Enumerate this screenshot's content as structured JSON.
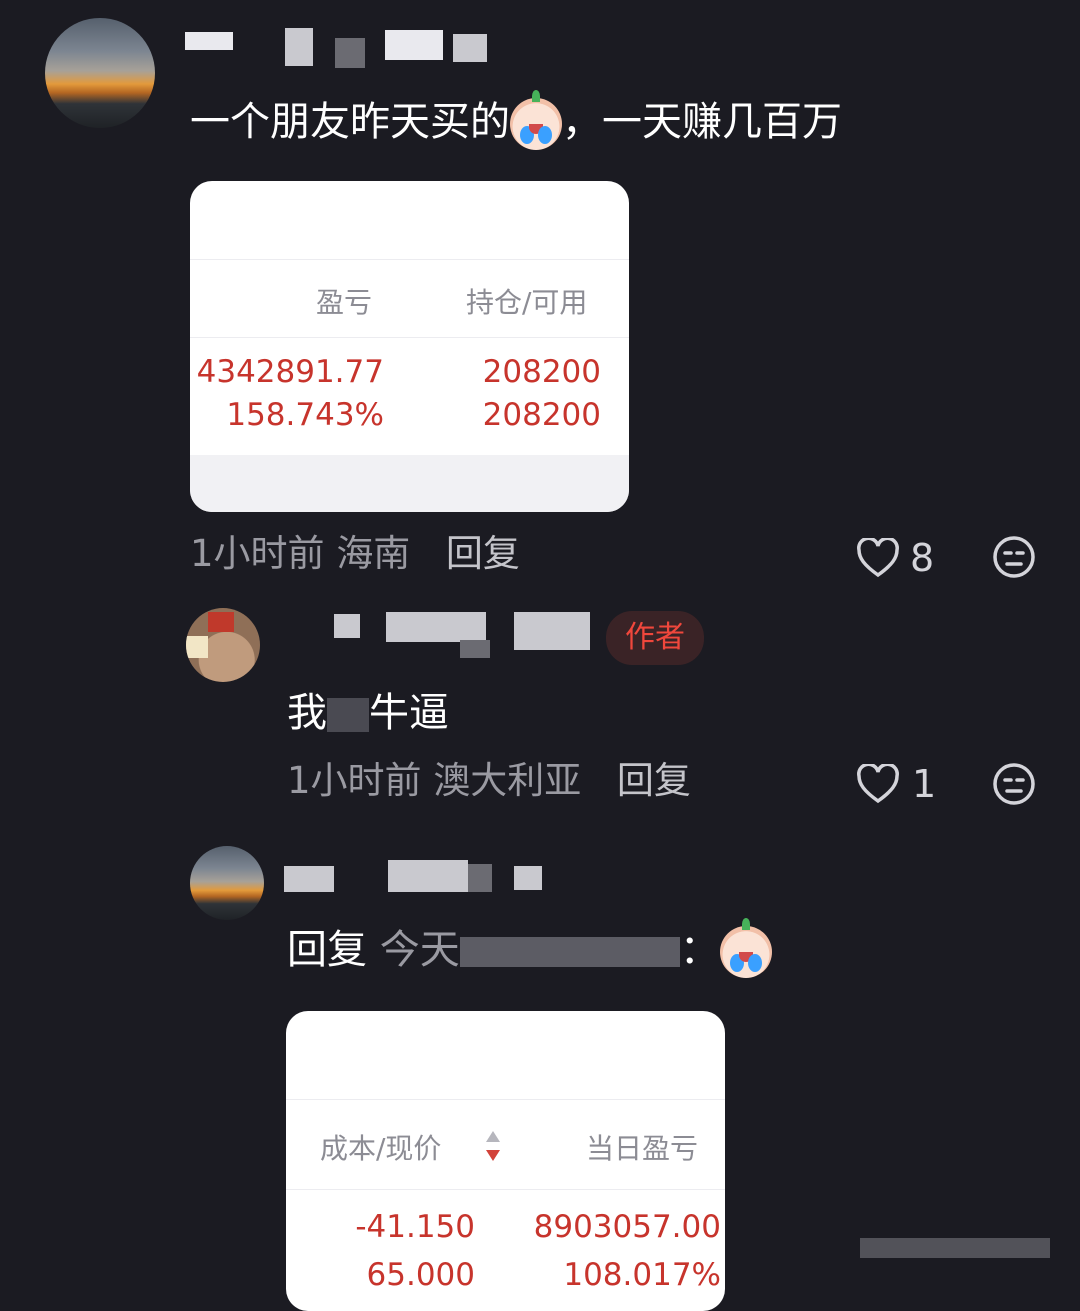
{
  "comment1": {
    "text_before": "一个朋友昨天买的",
    "text_after": "，一天赚几百万",
    "emoji": "crying-laughing-emoji",
    "card": {
      "col1_header": "盈亏",
      "col2_header": "持仓/可用",
      "pl_value": "4342891.77",
      "pl_pct": "158.743%",
      "pos_value": "208200",
      "avail_value": "208200"
    },
    "meta": {
      "time": "1小时前",
      "location": "海南",
      "reply": "回复",
      "likes": "8"
    }
  },
  "reply1": {
    "badge": "作者",
    "text_start": "我",
    "text_end": "牛逼",
    "meta": {
      "time": "1小时前",
      "location": "澳大利亚",
      "reply": "回复",
      "likes": "1"
    }
  },
  "reply2": {
    "reply_prefix": "回复",
    "reply_target_start": "今天",
    "text_suffix": "：",
    "emoji": "crying-laughing-emoji",
    "card": {
      "col1_header": "成本/现价",
      "col2_header": "当日盈亏",
      "cost": "-41.150",
      "price": "65.000",
      "day_pl": "8903057.00",
      "day_pct": "108.017%"
    }
  },
  "colors": {
    "background": "#1b1b22",
    "muted_text": "#9a9aa2",
    "red_value": "#c7342c",
    "author_badge_text": "#f0473c"
  }
}
